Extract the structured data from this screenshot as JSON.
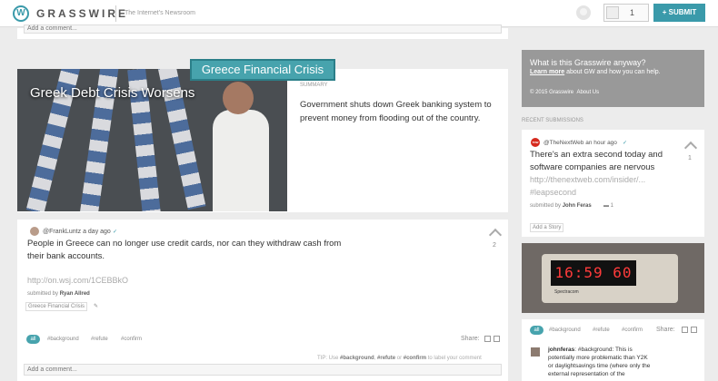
{
  "header": {
    "brand": "GRASSWIRE",
    "tagline": "The Internet's Newsroom",
    "notif_count": "1",
    "submit_label": "+ SUBMIT"
  },
  "prev_card": {
    "add_comment_placeholder": "Add a comment..."
  },
  "story": {
    "image_title": "Greek Debt Crisis Worsens",
    "topic": "Greece Financial Crisis",
    "summary_label": "SUMMARY",
    "summary": "Government shuts down Greek banking system to prevent money from flooding out of the country."
  },
  "post": {
    "handle": "@FrankLuntz a day ago",
    "line1": "People in Greece can no longer use credit cards, nor can they withdraw cash from",
    "line2": "their bank accounts.",
    "link": "http://on.wsj.com/1CEBBkO",
    "submitted_prefix": "submitted by",
    "submitter": "Ryan Allred",
    "tag": "Greece Financial Crisis",
    "votes": "2",
    "filters": {
      "all": "all",
      "background": "#background",
      "refute": "#refute",
      "confirm": "#confirm"
    },
    "share_label": "Share:",
    "tip_prefix": "TIP: Use",
    "tip_bg": "#background",
    "tip_refute": "#refute",
    "tip_or": "or",
    "tip_confirm": "#confirm",
    "tip_suffix": "to label your comment",
    "add_comment_placeholder": "Add a comment..."
  },
  "sidebar": {
    "about_q": "What is this Grasswire anyway?",
    "learn_more": "Learn more",
    "learn_rest": "about GW and how you can help.",
    "copyright": "© 2015 Grasswire",
    "about_link": "About Us",
    "recent_label": "RECENT SUBMISSIONS",
    "rs": {
      "badge": "TNW",
      "handle": "@TheNextWeb an hour ago",
      "line1": "There's an extra second today and",
      "line2": "software companies are nervous",
      "link": "http://thenextweb.com/insider/...",
      "hashtag": "#leapsecond",
      "submitted_prefix": "submitted by",
      "submitter": "John Feras",
      "comments": "1",
      "votes": "1",
      "add_story": "Add a Story"
    },
    "clock": {
      "time": "16:59 60",
      "brand": "Spectracom"
    },
    "filters": {
      "all": "all",
      "background": "#background",
      "refute": "#refute",
      "confirm": "#confirm"
    },
    "share_label": "Share:",
    "comment": {
      "user": "johnferas",
      "l1": ": #background: This is",
      "l2": "potentially more problematic than Y2K",
      "l3": "or daylightsavings time (where only the",
      "l4": "external representation of the"
    }
  }
}
